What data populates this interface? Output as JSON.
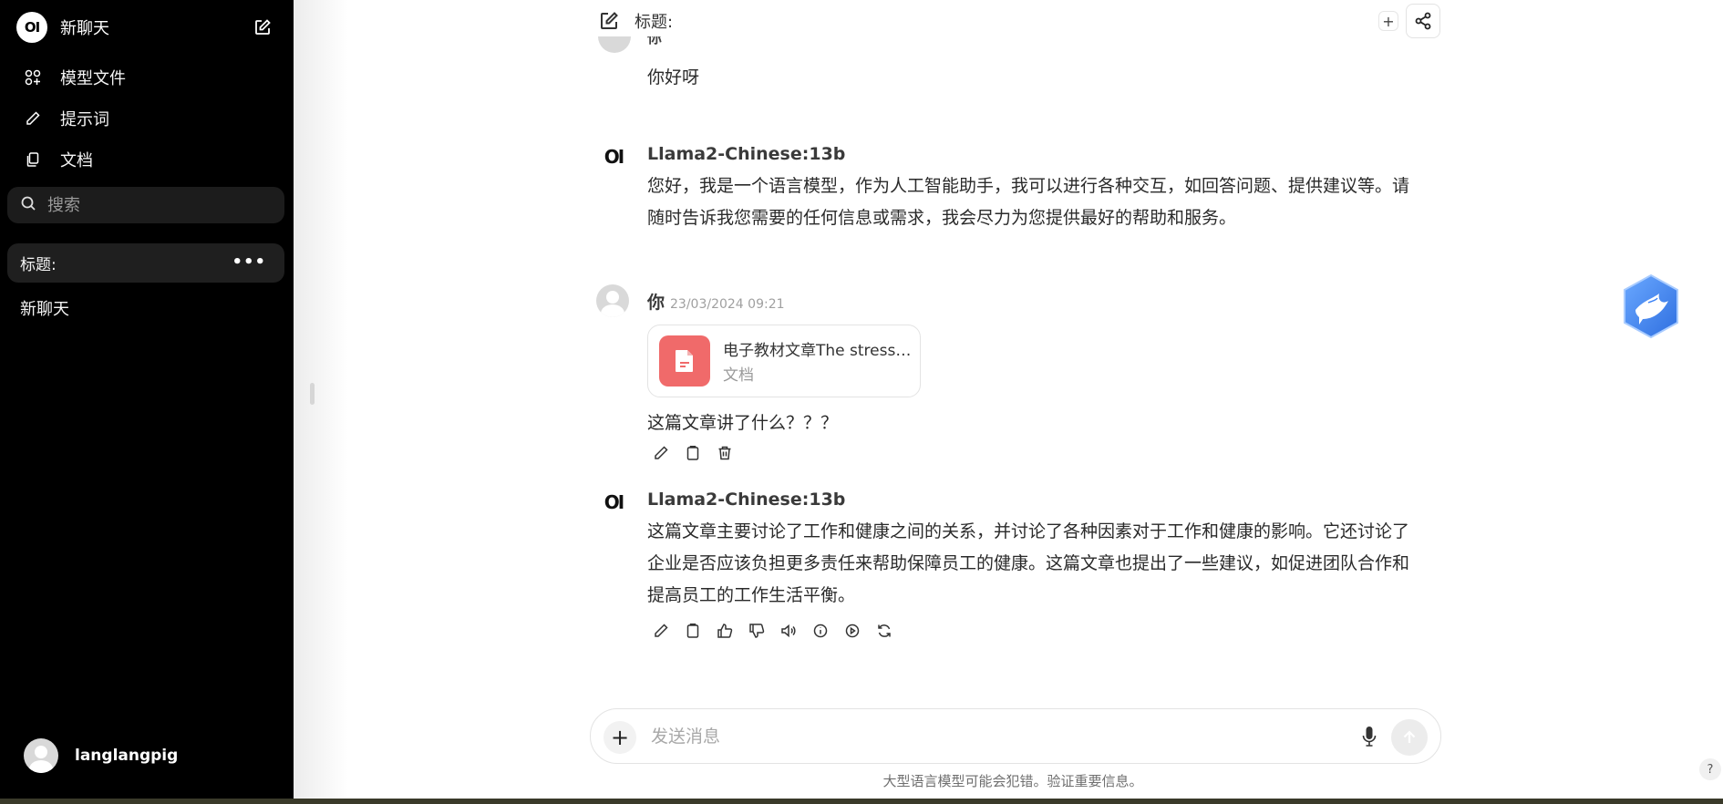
{
  "sidebar": {
    "logo": "OI",
    "new_chat": "新聊天",
    "nav": [
      {
        "label": "模型文件",
        "icon": "models-icon"
      },
      {
        "label": "提示词",
        "icon": "pencil-icon"
      },
      {
        "label": "文档",
        "icon": "documents-icon"
      }
    ],
    "search_placeholder": "搜索",
    "active_chat": "标题:",
    "chats": [
      "新聊天"
    ],
    "username": "langlangpig"
  },
  "header": {
    "title": "标题:"
  },
  "messages": [
    {
      "role": "user",
      "name": "你",
      "text": "你好呀"
    },
    {
      "role": "assistant",
      "name": "Llama2-Chinese:13b",
      "logo": "OI",
      "text": "您好，我是一个语言模型，作为人工智能助手，我可以进行各种交互，如回答问题、提供建议等。请随时告诉我您需要的任何信息或需求，我会尽力为您提供最好的帮助和服务。"
    },
    {
      "role": "user",
      "name": "你",
      "timestamp": "23/03/2024 09:21",
      "file": {
        "name": "电子教材文章The stress of work in modern life.pdf",
        "type": "文档"
      },
      "text": "这篇文章讲了什么？？？"
    },
    {
      "role": "assistant",
      "name": "Llama2-Chinese:13b",
      "logo": "OI",
      "text": "这篇文章主要讨论了工作和健康之间的关系，并讨论了各种因素对于工作和健康的影响。它还讨论了企业是否应该负担更多责任来帮助保障员工的健康。这篇文章也提出了一些建议，如促进团队合作和提高员工的工作生活平衡。"
    }
  ],
  "composer": {
    "placeholder": "发送消息",
    "plus": "+"
  },
  "disclaimer": "大型语言模型可能会犯错。验证重要信息。",
  "help": "?",
  "colors": {
    "sidebar_bg": "#000000",
    "file_icon": "#f06a6a",
    "floater": "#3b82f6"
  }
}
